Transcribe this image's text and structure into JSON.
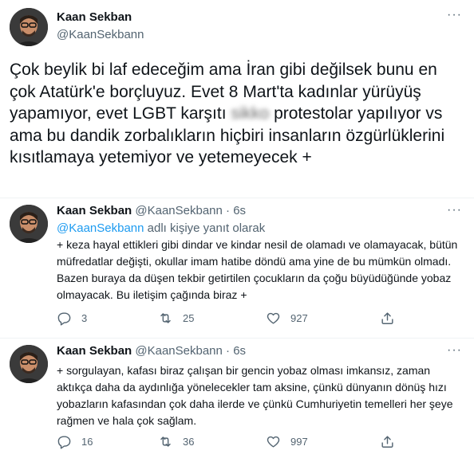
{
  "main_tweet": {
    "author_name": "Kaan Sekban",
    "author_handle": "@KaanSekbann",
    "text_before": "Çok beylik bi laf edeceğim ama İran gibi değilsek bunu en çok Atatürk'e borçluyuz. Evet 8 Mart'ta kadınlar yürüyüş yapamıyor, evet LGBT karşıtı ",
    "blurred_word": "sikko",
    "text_after": " protestolar yapılıyor vs ama bu dandik zorbalıkların hiçbiri insanların özgürlüklerini kısıtlamaya yetemiyor ve yetemeyecek +"
  },
  "replies": [
    {
      "author_name": "Kaan Sekban",
      "author_handle": "@KaanSekbann",
      "separator": "·",
      "time": "6s",
      "mention": "@KaanSekbann",
      "reply_to_suffix": " adlı kişiye yanıt olarak",
      "text": "+ keza hayal ettikleri gibi dindar ve kindar nesil de olamadı ve olamayacak, bütün müfredatlar değişti, okullar imam hatibe döndü ama yine de bu mümkün olmadı. Bazen buraya da düşen tekbir getirtilen çocukların da çoğu büyüdüğünde yobaz olmayacak. Bu iletişim çağında biraz +",
      "replies_count": "3",
      "retweets_count": "25",
      "likes_count": "927"
    },
    {
      "author_name": "Kaan Sekban",
      "author_handle": "@KaanSekbann",
      "separator": "·",
      "time": "6s",
      "text": "+ sorgulayan, kafası biraz çalışan bir gencin yobaz olması imkansız, zaman aktıkça daha da aydınlığa yönelecekler tam aksine, çünkü dünyanın dönüş hızı yobazların kafasından çok daha ilerde ve çünkü Cumhuriyetin temelleri her şeye rağmen ve  hala çok sağlam.",
      "replies_count": "16",
      "retweets_count": "36",
      "likes_count": "997"
    }
  ],
  "icons": {
    "more": "more-dots-icon",
    "reply": "reply-icon",
    "retweet": "retweet-icon",
    "like": "heart-icon",
    "share": "share-icon"
  },
  "colors": {
    "text": "#0f1419",
    "secondary": "#536471",
    "link": "#1d9bf0",
    "divider": "#eff3f4"
  }
}
